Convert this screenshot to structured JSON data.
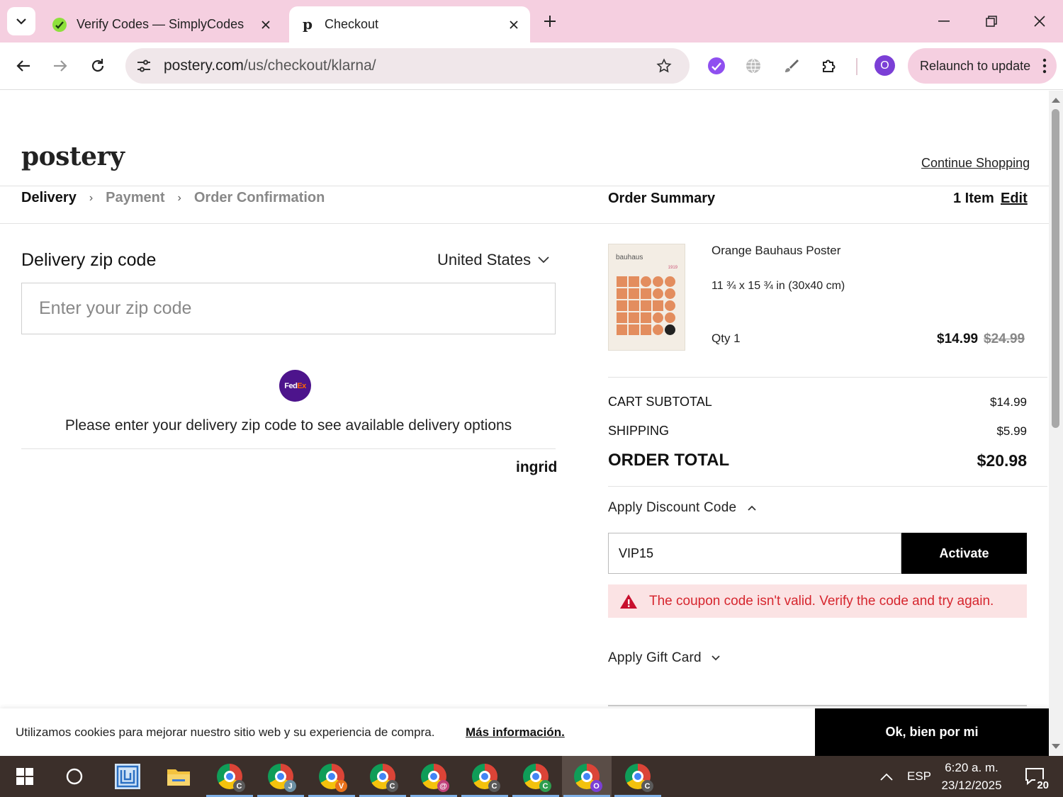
{
  "browser": {
    "tabs": [
      {
        "title": "Verify Codes — SimplyCodes",
        "active": false,
        "icon": "simplycodes-favicon"
      },
      {
        "title": "Checkout",
        "active": true,
        "icon": "postery-favicon"
      }
    ],
    "url_domain": "postery.com",
    "url_path": "/us/checkout/klarna/",
    "profile_initial": "O",
    "relaunch_label": "Relaunch to update",
    "accent": "#f5cfe0"
  },
  "site": {
    "logo": "postery",
    "continue_shopping": "Continue Shopping"
  },
  "breadcrumb": {
    "steps": [
      "Delivery",
      "Payment",
      "Order Confirmation"
    ],
    "current": "Delivery"
  },
  "delivery": {
    "label": "Delivery zip code",
    "country": "United States",
    "zip_placeholder": "Enter your zip code",
    "zip_value": "",
    "carrier_fed": "Fed",
    "carrier_ex": "Ex",
    "message": "Please enter your delivery zip code to see available delivery options",
    "provider": "ingrid"
  },
  "order_summary": {
    "title": "Order Summary",
    "item_count": "1 Item",
    "edit_label": "Edit",
    "product": {
      "name": "Orange Bauhaus Poster",
      "size": "11 ¾ x 15 ¾ in (30x40 cm)",
      "qty": "Qty 1",
      "price": "$14.99",
      "original_price": "$24.99",
      "image_brand": "bauhaus",
      "image_year": "1919"
    },
    "cart_subtotal_label": "CART SUBTOTAL",
    "cart_subtotal": "$14.99",
    "shipping_label": "SHIPPING",
    "shipping": "$5.99",
    "order_total_label": "ORDER TOTAL",
    "order_total": "$20.98",
    "discount_label": "Apply Discount Code",
    "discount_value": "VIP15",
    "activate_label": "Activate",
    "error_message": "The coupon code isn't valid. Verify the code and try again.",
    "error_color": "#d6262e",
    "gift_card_label": "Apply Gift Card"
  },
  "cookie_banner": {
    "message": "Utilizamos cookies para mejorar nuestro sitio web y su experiencia de compra.",
    "more_label": "Más información.",
    "ok_label": "Ok, bien por mi"
  },
  "taskbar": {
    "apps": [
      {
        "name": "chrome",
        "badge": "C",
        "badge_color": "#5a5a5a"
      },
      {
        "name": "chrome",
        "badge": "J",
        "badge_color": "#6b8fa3"
      },
      {
        "name": "chrome",
        "badge": "V",
        "badge_color": "#e8711a"
      },
      {
        "name": "chrome",
        "badge": "C",
        "badge_color": "#5a5a5a"
      },
      {
        "name": "chrome",
        "badge": "@",
        "badge_color": "#c0417a"
      },
      {
        "name": "chrome",
        "badge": "C",
        "badge_color": "#5a5a5a"
      },
      {
        "name": "chrome",
        "badge": "C",
        "badge_color": "#2e9d4f"
      },
      {
        "name": "chrome",
        "badge": "O",
        "badge_color": "#7b3fd6"
      },
      {
        "name": "chrome",
        "badge": "C",
        "badge_color": "#5a5a5a"
      }
    ],
    "language": "ESP",
    "time": "6:20 a. m.",
    "date": "23/12/2025",
    "notifications": "20"
  }
}
